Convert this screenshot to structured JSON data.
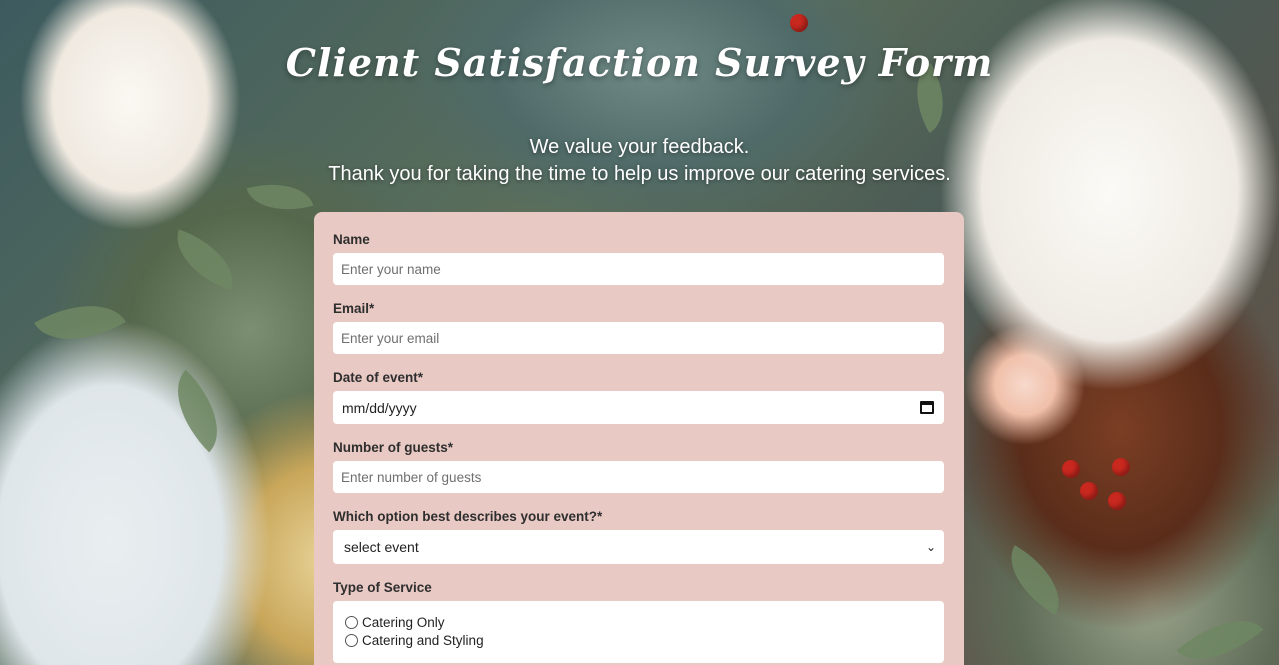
{
  "header": {
    "title": "Client Satisfaction Survey Form",
    "subtitle_line1": "We value your feedback.",
    "subtitle_line2": "Thank you for taking the time to help us improve our catering services."
  },
  "form": {
    "name": {
      "label": "Name",
      "placeholder": "Enter your name"
    },
    "email": {
      "label": "Email*",
      "placeholder": "Enter your email"
    },
    "date": {
      "label": "Date of event*",
      "value": "mm/dd/yyyy"
    },
    "guests": {
      "label": "Number of guests*",
      "placeholder": "Enter number of guests"
    },
    "event_type": {
      "label": "Which option best describes your event?*",
      "selected": "select event"
    },
    "service": {
      "label": "Type of Service",
      "options": [
        "Catering Only",
        "Catering and Styling"
      ]
    }
  },
  "colors": {
    "card_background": "#e9c9c4",
    "title_text": "#ffffff"
  }
}
